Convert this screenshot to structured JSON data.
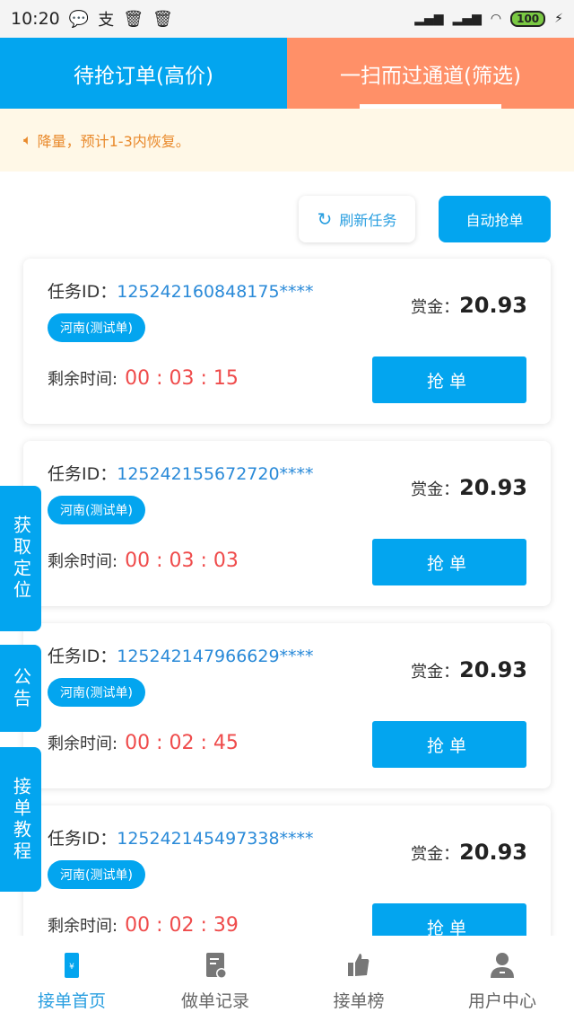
{
  "status_bar": {
    "time": "10:20",
    "battery": "100"
  },
  "tabs": [
    {
      "label": "待抢订单(高价)",
      "active": false
    },
    {
      "label": "一扫而过通道(筛选)",
      "active": true
    }
  ],
  "notice": {
    "text": "降量，预计1-3内恢复。"
  },
  "actions": {
    "refresh": "刷新任务",
    "auto": "自动抢单"
  },
  "labels": {
    "id": "任务ID：",
    "reward": "赏金：",
    "time": "剩余时间:",
    "grab": "抢单"
  },
  "orders": [
    {
      "id": "125242160848175****",
      "tag": "河南(测试单)",
      "reward": "20.93",
      "time": "00 : 03 : 15"
    },
    {
      "id": "125242155672720****",
      "tag": "河南(测试单)",
      "reward": "20.93",
      "time": "00 : 03 : 03"
    },
    {
      "id": "125242147966629****",
      "tag": "河南(测试单)",
      "reward": "20.93",
      "time": "00 : 02 : 45"
    },
    {
      "id": "125242145497338****",
      "tag": "河南(测试单)",
      "reward": "20.93",
      "time": "00 : 02 : 39"
    }
  ],
  "side_tabs": [
    "获取定位",
    "公告",
    "接单教程"
  ],
  "nav": [
    {
      "label": "接单首页",
      "active": true
    },
    {
      "label": "做单记录"
    },
    {
      "label": "接单榜"
    },
    {
      "label": "用户中心"
    }
  ],
  "colors": {
    "primary": "#03a5ef",
    "accent": "#ff9068",
    "countdown": "#ef4b4b"
  }
}
